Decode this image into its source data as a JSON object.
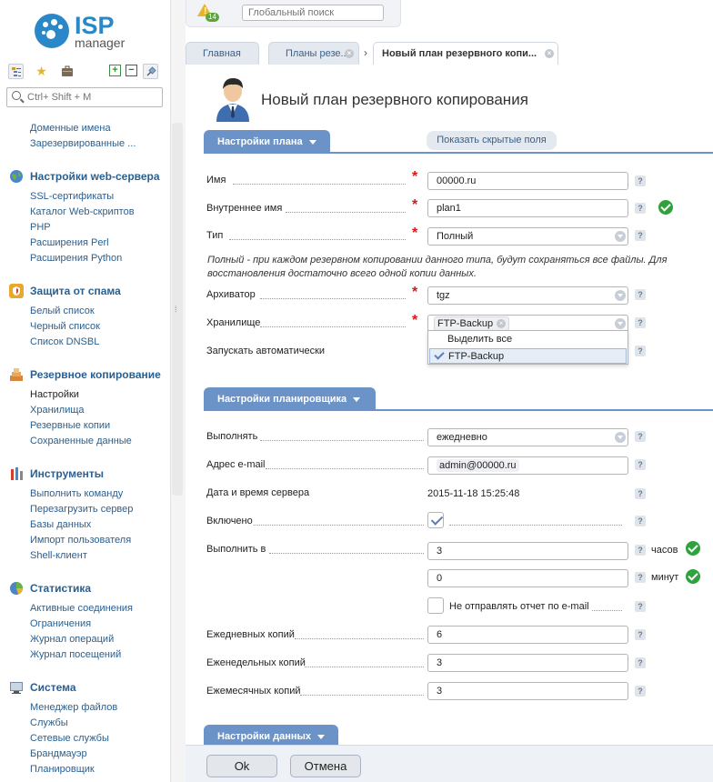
{
  "logo": {
    "brand": "ISP",
    "product": "manager"
  },
  "sidebar": {
    "search_placeholder": "Ctrl+ Shift + M",
    "top_items": [
      "Доменные имена",
      "Зарезервированные ..."
    ],
    "groups": [
      {
        "title": "Настройки web-сервера",
        "icon": "globe-icon",
        "items": [
          "SSL-сертификаты",
          "Каталог Web-скриптов",
          "PHP",
          "Расширения Perl",
          "Расширения Python"
        ]
      },
      {
        "title": "Защита от спама",
        "icon": "shield-icon",
        "items": [
          "Белый список",
          "Черный список",
          "Список DNSBL"
        ]
      },
      {
        "title": "Резервное копирование",
        "icon": "backup-icon",
        "items": [
          "Настройки",
          "Хранилища",
          "Резервные копии",
          "Сохраненные данные"
        ],
        "active": "Настройки"
      },
      {
        "title": "Инструменты",
        "icon": "tools-icon",
        "items": [
          "Выполнить команду",
          "Перезагрузить сервер",
          "Базы данных",
          "Импорт пользователя",
          "Shell-клиент"
        ]
      },
      {
        "title": "Статистика",
        "icon": "chart-icon",
        "items": [
          "Активные соединения",
          "Ограничения",
          "Журнал операций",
          "Журнал посещений"
        ]
      },
      {
        "title": "Система",
        "icon": "system-icon",
        "items": [
          "Менеджер файлов",
          "Службы",
          "Сетевые службы",
          "Брандмауэр",
          "Планировщик"
        ]
      }
    ]
  },
  "topbar": {
    "notifications_count": "14",
    "search_placeholder": "Глобальный поиск"
  },
  "tabs": [
    {
      "label": "Главная",
      "closable": false
    },
    {
      "label": "Планы резе...",
      "closable": true
    },
    {
      "label": "Новый план резервного копи...",
      "closable": true,
      "active": true
    }
  ],
  "page": {
    "title": "Новый план резервного копирования",
    "show_hidden_label": "Показать скрытые поля",
    "plan_section": {
      "title": "Настройки плана",
      "name_label": "Имя",
      "name_value": "00000.ru",
      "internal_label": "Внутреннее имя",
      "internal_value": "plan1",
      "type_label": "Тип",
      "type_value": "Полный",
      "type_desc": "Полный - при каждом резервном копировании данного типа, будут сохраняться все файлы. Для восстановления достаточно всего одной копии данных.",
      "archiver_label": "Архиватор",
      "archiver_value": "tgz",
      "storage_label": "Хранилище",
      "storage_value": "FTP-Backup",
      "storage_options": [
        "Выделить все",
        "FTP-Backup"
      ],
      "autorun_label": "Запускать автоматически"
    },
    "scheduler_section": {
      "title": "Настройки планировщика",
      "run_label": "Выполнять",
      "run_value": "ежедневно",
      "email_label": "Адрес e-mail",
      "email_value": "admin@00000.ru",
      "datetime_label": "Дата и время сервера",
      "datetime_value": "2015-11-18 15:25:48",
      "enabled_label": "Включено",
      "enabled": true,
      "run_at_label": "Выполнить в",
      "hours_value": "3",
      "hours_unit": "часов",
      "minutes_value": "0",
      "minutes_unit": "минут",
      "no_report_label": "Не отправлять отчет по e-mail",
      "no_report": false,
      "daily_label": "Ежедневных копий",
      "daily_value": "6",
      "weekly_label": "Еженедельных копий",
      "weekly_value": "3",
      "monthly_label": "Ежемесячных копий",
      "monthly_value": "3"
    },
    "data_section": {
      "title": "Настройки данных"
    }
  },
  "footer": {
    "ok_label": "Ok",
    "cancel_label": "Отмена"
  },
  "colors": {
    "accent": "#6c93c8",
    "link": "#2a5f8f",
    "required": "#d21a1a",
    "success": "#2fa33b"
  }
}
